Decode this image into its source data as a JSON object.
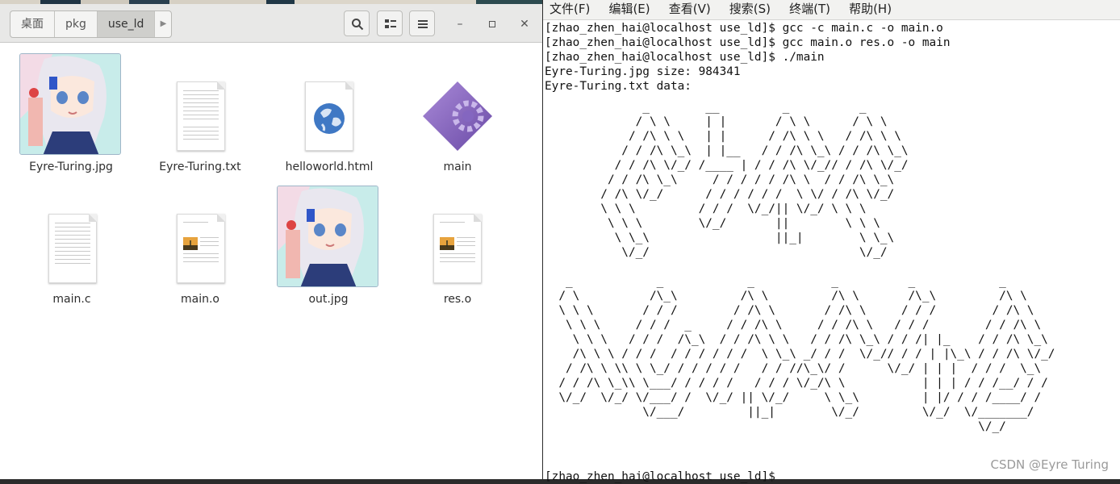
{
  "file_manager": {
    "breadcrumb": [
      "桌面",
      "pkg",
      "use_ld"
    ],
    "files": [
      {
        "name": "Eyre-Turing.jpg",
        "icon": "image-thumbnail-icon"
      },
      {
        "name": "Eyre-Turing.txt",
        "icon": "text-file-icon"
      },
      {
        "name": "helloworld.html",
        "icon": "html-globe-icon"
      },
      {
        "name": "main",
        "icon": "executable-diamond-icon"
      },
      {
        "name": "main.c",
        "icon": "text-file-icon"
      },
      {
        "name": "main.o",
        "icon": "document-with-image-icon"
      },
      {
        "name": "out.jpg",
        "icon": "image-thumbnail-icon"
      },
      {
        "name": "res.o",
        "icon": "document-with-image-icon"
      }
    ]
  },
  "terminal": {
    "menu": [
      "文件(F)",
      "编辑(E)",
      "查看(V)",
      "搜索(S)",
      "终端(T)",
      "帮助(H)"
    ],
    "lines": [
      "[zhao_zhen_hai@localhost use_ld]$ gcc -c main.c -o main.o",
      "[zhao_zhen_hai@localhost use_ld]$ gcc main.o res.o -o main",
      "[zhao_zhen_hai@localhost use_ld]$ ./main",
      "Eyre-Turing.jpg size: 984341",
      "Eyre-Turing.txt data:"
    ],
    "ascii_art": "              _        __         _          _\n             / \\ \\     | |       / \\ \\      / \\ \\\n            / /\\ \\ \\   | |      / /\\ \\ \\   / /\\ \\ \\\n           / / /\\ \\_\\  | |__   / / /\\ \\_\\ / / /\\ \\_\\\n          / / /\\ \\/_/ /____ | / / /\\ \\/_// / /\\ \\/_/\n         / / /\\ \\_\\     / / / / / /\\ \\  / / /\\ \\_\\\n        / /\\ \\/_/      / / / / / /  \\ \\/ / /\\ \\/_/\n        \\ \\ \\         / / /  \\/_/|| \\/_/ \\ \\ \\\n         \\ \\ \\        \\/_/       ||        \\ \\ \\\n          \\ \\_\\                  ||_|        \\ \\_\\\n           \\/_/                              \\/_/\n\n   _            _            _           _          _            _\n  / \\          /\\_\\         /\\ \\         /\\ \\       /\\_\\         /\\ \\\n  \\ \\ \\       / / /        / /\\ \\       / /\\ \\     / / /        / /\\ \\\n   \\ \\ \\     / / /  _     / / /\\ \\     / / /\\ \\   / / /        / / /\\ \\\n    \\ \\ \\   / / /  /\\_\\  / / /\\ \\ \\   / / /\\ \\_\\ / / /| |_    / / /\\ \\_\\\n    /\\ \\ \\ / / /  / / / / / /  \\ \\_\\ _/ / /  \\/_// / / | |\\_\\ / / /\\ \\/_/\n   / /\\ \\ \\\\ \\ \\_/ / / / / /   / / //\\_\\/ /      \\/_/ | | |  / / /  \\_\\\n  / / /\\ \\_\\\\ \\___/ / / / /   / / / \\/_/\\ \\           | | | / / /__/ / /\n  \\/_/  \\/_/ \\/___/ /  \\/_/ || \\/_/     \\ \\_\\         | |/ / / /____/ /\n              \\/___/         ||_|        \\/_/         \\/_/  \\/_______/\n                                                              \\/_/",
    "last_prompt": "[zhao_zhen_hai@localhost use_ld]$"
  },
  "watermark": "CSDN @Eyre Turing"
}
